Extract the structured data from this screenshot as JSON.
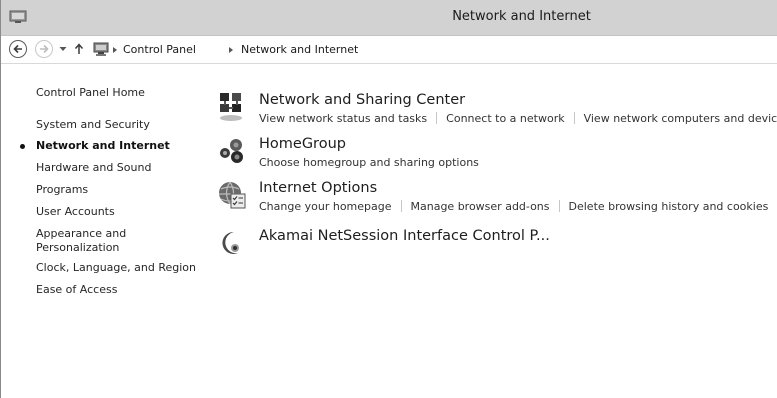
{
  "window": {
    "title": "Network and Internet"
  },
  "addressbar": {
    "breadcrumbs": [
      "Control Panel",
      "Network and Internet"
    ]
  },
  "leftnav": {
    "items": [
      {
        "label": "Control Panel Home"
      },
      {
        "label": "System and Security"
      },
      {
        "label": "Network and Internet",
        "current": true
      },
      {
        "label": "Hardware and Sound"
      },
      {
        "label": "Programs"
      },
      {
        "label": "User Accounts"
      },
      {
        "label": "Appearance and"
      },
      {
        "label": "Personalization"
      },
      {
        "label": "Clock, Language, and Region"
      },
      {
        "label": "Ease of Access"
      }
    ]
  },
  "categories": [
    {
      "title": "Network and Sharing Center",
      "icon": "network-sharing-icon",
      "links": [
        "View network status and tasks",
        "Connect to a network",
        "View network computers and devices"
      ]
    },
    {
      "title": "HomeGroup",
      "icon": "homegroup-icon",
      "links": [
        "Choose homegroup and sharing options"
      ]
    },
    {
      "title": "Internet Options",
      "icon": "internet-options-icon",
      "links": [
        "Change your homepage",
        "Manage browser add-ons",
        "Delete browsing history and cookies"
      ]
    },
    {
      "title": "Akamai NetSession Interface Control P...",
      "icon": "akamai-icon",
      "links": []
    }
  ]
}
